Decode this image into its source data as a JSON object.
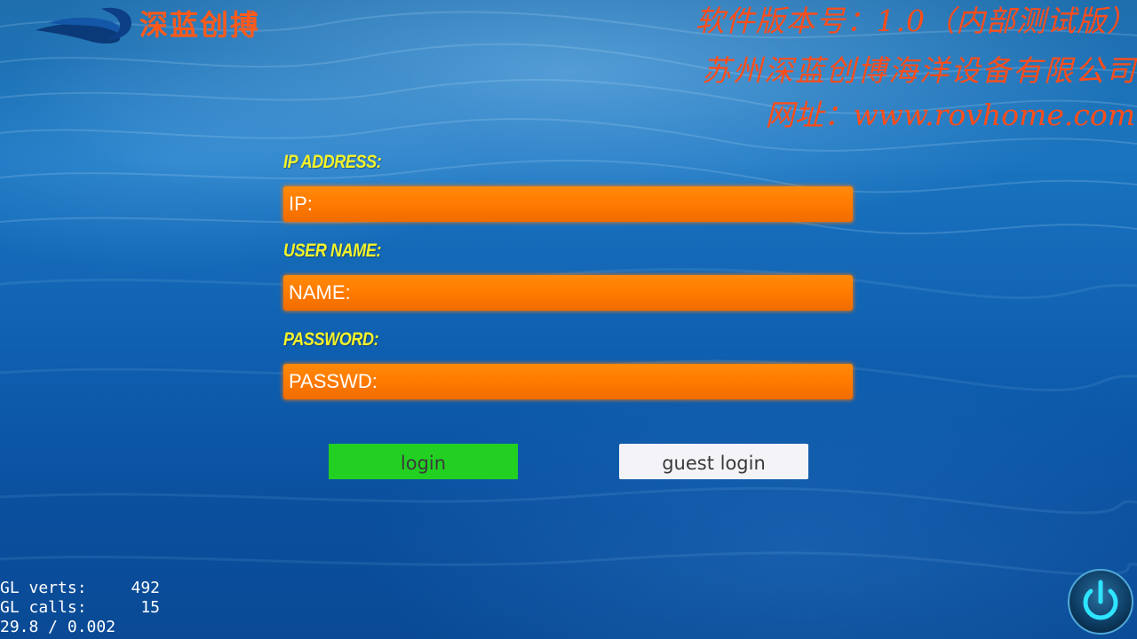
{
  "header": {
    "logo_text": "深蓝创搏",
    "version": "软件版本号：1.0（内部测试版）",
    "company": "苏州深蓝创博海洋设备有限公司",
    "website": "网址：www.rovhome.com"
  },
  "form": {
    "ip_label": "IP ADDRESS:",
    "ip_placeholder": "IP:",
    "ip_value": "",
    "name_label": "USER NAME:",
    "name_placeholder": "NAME:",
    "name_value": "",
    "password_label": "PASSWORD:",
    "password_placeholder": "PASSWD:",
    "password_value": ""
  },
  "buttons": {
    "login": "login",
    "guest_login": "guest login"
  },
  "stats": {
    "verts_label": "GL verts:",
    "verts_value": "492",
    "calls_label": "GL calls:",
    "calls_value": "15",
    "fps": "29.8 / 0.002"
  },
  "icons": {
    "logo": "wave-logo-icon",
    "power": "power-icon"
  },
  "colors": {
    "input_fill": "#ff7a00",
    "label_text": "#f4f32a",
    "header_text": "#ff4d1a",
    "login_button": "#22d022",
    "guest_button": "#f4f4f8"
  }
}
